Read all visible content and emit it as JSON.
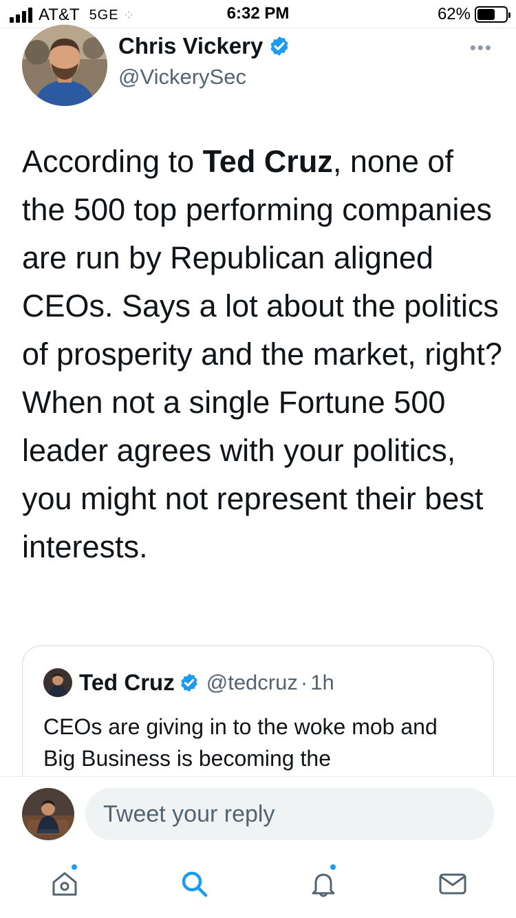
{
  "status_bar": {
    "carrier": "AT&T",
    "network": "5GE",
    "time": "6:32 PM",
    "battery": "62%",
    "battery_level": 0.62
  },
  "tweet": {
    "author_name": "Chris Vickery",
    "author_handle": "@VickerySec",
    "verified": true,
    "text_intro": "According to ",
    "text_bold": "Ted Cruz",
    "text_rest": ", none of the 500 top performing companies are run by Republican aligned CEOs. Says a lot about the politics of prosperity and the market, right? When not a single Fortune 500 leader agrees with your politics, you might not represent their best interests."
  },
  "quoted_tweet": {
    "author_name": "Ted Cruz",
    "author_handle": "@tedcruz",
    "separator": "·",
    "time": "1h",
    "verified": true,
    "text": "CEOs are giving in to the woke mob and Big Business is becoming the"
  },
  "reply": {
    "placeholder": "Tweet your reply"
  },
  "nav": {
    "items": [
      {
        "icon": "home-icon",
        "has_dot": true
      },
      {
        "icon": "search-icon",
        "has_dot": false
      },
      {
        "icon": "bell-icon",
        "has_dot": true
      },
      {
        "icon": "mail-icon",
        "has_dot": false
      }
    ]
  },
  "colors": {
    "accent": "#1d9bf0",
    "text": "#0f1419",
    "secondary_text": "#536471",
    "border": "#cfd9de"
  }
}
